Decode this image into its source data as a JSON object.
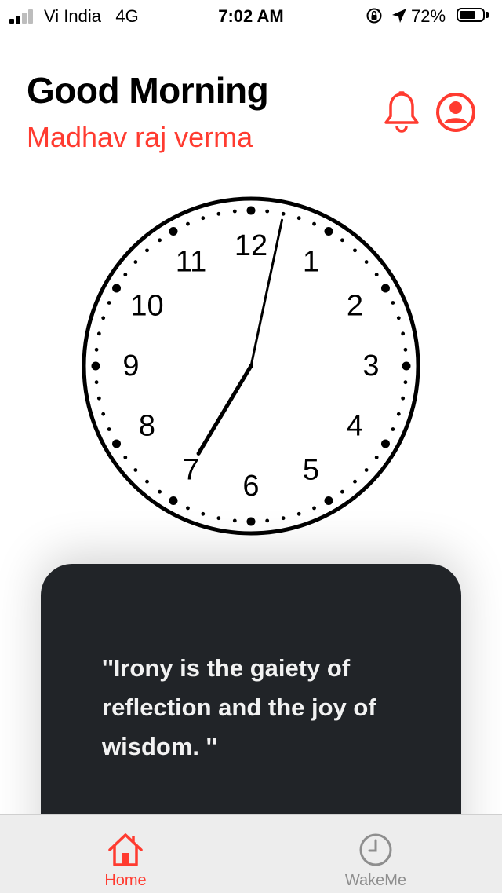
{
  "status_bar": {
    "carrier": "Vi India",
    "network": "4G",
    "time": "7:02 AM",
    "battery_percent": "72%",
    "battery_level": 0.72,
    "signal_bars": 2,
    "icons": [
      "signal-icon",
      "orientation-lock-icon",
      "location-arrow-icon",
      "battery-icon"
    ]
  },
  "header": {
    "greeting": "Good Morning",
    "user_name": "Madhav raj verma",
    "icons": [
      "bell-icon",
      "profile-icon"
    ]
  },
  "analog_clock": {
    "hour": 7,
    "minute": 2,
    "numerals": [
      "12",
      "1",
      "2",
      "3",
      "4",
      "5",
      "6",
      "7",
      "8",
      "9",
      "10",
      "11"
    ]
  },
  "quote": {
    "text": "''Irony is the gaiety of reflection and the joy of wisdom. ''"
  },
  "tab_bar": {
    "tabs": [
      {
        "label": "Home",
        "icon": "home-icon",
        "active": true
      },
      {
        "label": "WakeMe",
        "icon": "clock-icon",
        "active": false
      }
    ]
  },
  "colors": {
    "accent": "#ff3b30",
    "card_bg": "#212428",
    "tab_inactive": "#8e8e8e",
    "tab_bar_bg": "#ededed"
  }
}
